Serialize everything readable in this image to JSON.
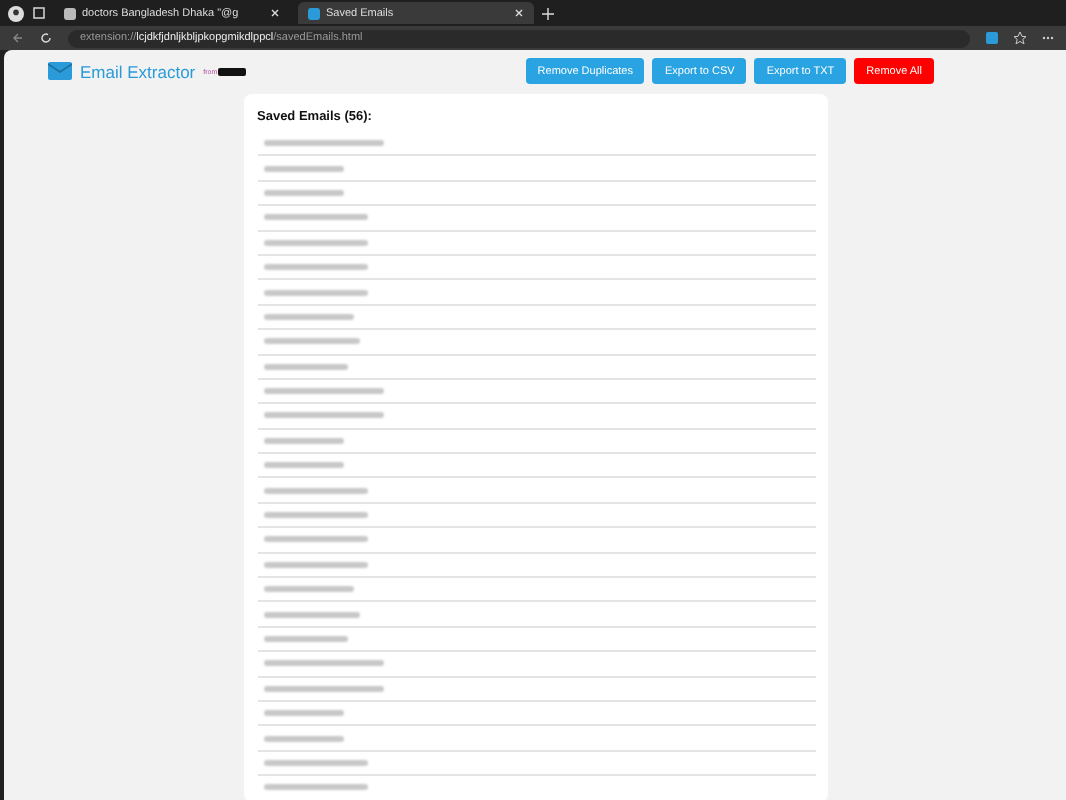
{
  "browser": {
    "tabs": [
      {
        "title": "doctors Bangladesh Dhaka \"@g",
        "selected": false
      },
      {
        "title": "Saved Emails",
        "selected": true
      }
    ],
    "address": {
      "scheme": "extension://",
      "path": "lcjdkfjdnljkbljpkopgmikdlppcl",
      "rest": "/savedEmails.html"
    }
  },
  "header": {
    "title": "Email Extractor",
    "from": "from"
  },
  "buttons": [
    {
      "label": "Remove Duplicates",
      "kind": "primary"
    },
    {
      "label": "Export to CSV",
      "kind": "primary"
    },
    {
      "label": "Export to TXT",
      "kind": "primary"
    },
    {
      "label": "Remove All",
      "kind": "danger"
    }
  ],
  "card": {
    "title": "Saved Emails (56):"
  },
  "email_rows": [
    {
      "kind": "blurred"
    },
    {
      "kind": "blurred"
    },
    {
      "kind": "blurred"
    },
    {
      "kind": "blurred"
    },
    {
      "kind": "blurred"
    },
    {
      "kind": "blurred"
    },
    {
      "kind": "blurred"
    },
    {
      "kind": "blurred"
    },
    {
      "kind": "blurred"
    },
    {
      "kind": "blurred"
    },
    {
      "kind": "blurred"
    },
    {
      "kind": "blurred"
    },
    {
      "kind": "blurred"
    },
    {
      "kind": "blurred"
    },
    {
      "kind": "blurred"
    },
    {
      "kind": "blurred"
    },
    {
      "kind": "blurred"
    },
    {
      "kind": "blurred"
    },
    {
      "kind": "blurred"
    },
    {
      "kind": "blurred"
    },
    {
      "kind": "blurred"
    },
    {
      "kind": "blurred"
    },
    {
      "kind": "blurred"
    },
    {
      "kind": "blurred"
    },
    {
      "kind": "blurred"
    },
    {
      "kind": "blurred"
    },
    {
      "kind": "blurred"
    }
  ]
}
